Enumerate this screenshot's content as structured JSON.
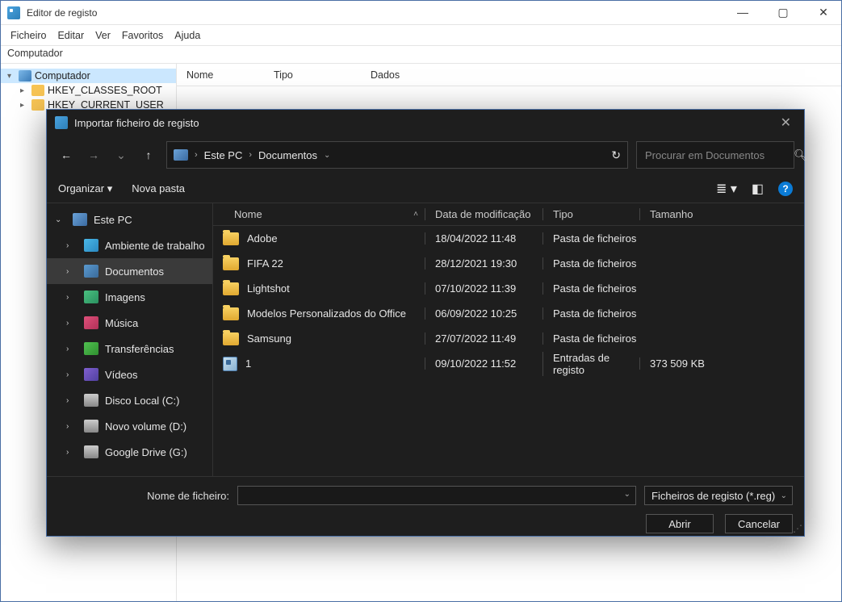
{
  "regedit": {
    "title": "Editor de registo",
    "menu": [
      "Ficheiro",
      "Editar",
      "Ver",
      "Favoritos",
      "Ajuda"
    ],
    "address": "Computador",
    "tree_root": "Computador",
    "tree_children": [
      "HKEY_CLASSES_ROOT",
      "HKEY_CURRENT_USER"
    ],
    "list_cols": [
      "Nome",
      "Tipo",
      "Dados"
    ]
  },
  "dialog": {
    "title": "Importar ficheiro de registo",
    "breadcrumb": [
      "Este PC",
      "Documentos"
    ],
    "search_placeholder": "Procurar em Documentos",
    "toolbar": {
      "organize": "Organizar",
      "new_folder": "Nova pasta"
    },
    "sidebar": [
      {
        "label": "Este PC",
        "icon": "i-pc",
        "expanded": true,
        "level": 0
      },
      {
        "label": "Ambiente de trabalho",
        "icon": "i-desk",
        "level": 1
      },
      {
        "label": "Documentos",
        "icon": "i-doc",
        "level": 1,
        "selected": true
      },
      {
        "label": "Imagens",
        "icon": "i-img",
        "level": 1
      },
      {
        "label": "Música",
        "icon": "i-mus",
        "level": 1
      },
      {
        "label": "Transferências",
        "icon": "i-dl",
        "level": 1
      },
      {
        "label": "Vídeos",
        "icon": "i-vid",
        "level": 1
      },
      {
        "label": "Disco Local (C:)",
        "icon": "i-drv",
        "level": 1
      },
      {
        "label": "Novo volume (D:)",
        "icon": "i-drv",
        "level": 1
      },
      {
        "label": "Google Drive (G:)",
        "icon": "i-drv",
        "level": 1
      }
    ],
    "columns": {
      "name": "Nome",
      "date": "Data de modificação",
      "type": "Tipo",
      "size": "Tamanho"
    },
    "files": [
      {
        "name": "Adobe",
        "date": "18/04/2022 11:48",
        "type": "Pasta de ficheiros",
        "size": "",
        "kind": "folder"
      },
      {
        "name": "FIFA 22",
        "date": "28/12/2021 19:30",
        "type": "Pasta de ficheiros",
        "size": "",
        "kind": "folder"
      },
      {
        "name": "Lightshot",
        "date": "07/10/2022 11:39",
        "type": "Pasta de ficheiros",
        "size": "",
        "kind": "folder"
      },
      {
        "name": "Modelos Personalizados do Office",
        "date": "06/09/2022 10:25",
        "type": "Pasta de ficheiros",
        "size": "",
        "kind": "folder"
      },
      {
        "name": "Samsung",
        "date": "27/07/2022 11:49",
        "type": "Pasta de ficheiros",
        "size": "",
        "kind": "folder"
      },
      {
        "name": "1",
        "date": "09/10/2022 11:52",
        "type": "Entradas de registo",
        "size": "373 509 KB",
        "kind": "reg"
      }
    ],
    "footer": {
      "filename_label": "Nome de ficheiro:",
      "filter": "Ficheiros de registo (*.reg)",
      "open": "Abrir",
      "cancel": "Cancelar"
    }
  }
}
